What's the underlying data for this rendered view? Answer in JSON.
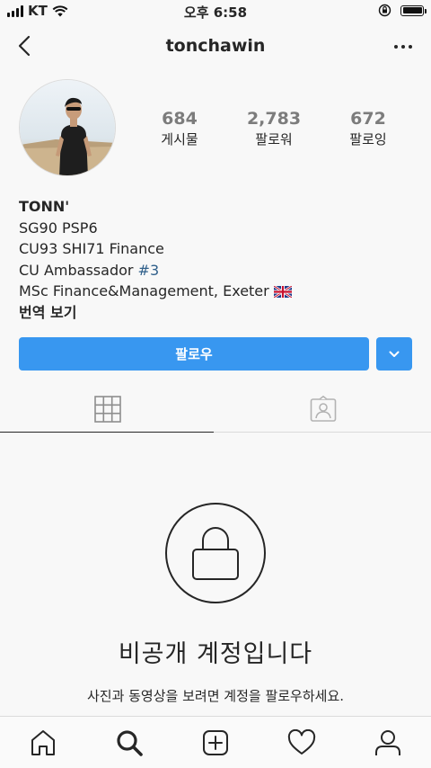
{
  "status_bar": {
    "carrier": "KT",
    "time": "오후 6:58"
  },
  "header": {
    "username": "tonchawin"
  },
  "profile": {
    "avatar": "profile-photo",
    "stats": [
      {
        "value": "684",
        "label": "게시물"
      },
      {
        "value": "2,783",
        "label": "팔로워"
      },
      {
        "value": "672",
        "label": "팔로잉"
      }
    ],
    "bio": {
      "name": "TONN'",
      "line1": "SG90 PSP6",
      "line2": "CU93 SHI71 Finance",
      "line3_text": "CU Ambassador ",
      "line3_hashtag": "#3",
      "line4": "MSc Finance&Management, Exeter",
      "translate_label": "번역 보기"
    }
  },
  "actions": {
    "follow_label": "팔로우"
  },
  "private": {
    "title": "비공개 계정입니다",
    "description": "사진과 동영상을 보려면 계정을 팔로우하세요."
  },
  "colors": {
    "accent": "#3897f0",
    "hashtag": "#2f5f8a",
    "background": "#f8f8f8"
  },
  "icons": {
    "tabs": [
      "grid-icon",
      "tagged-icon"
    ],
    "bottom_nav": [
      "home-icon",
      "search-icon",
      "add-post-icon",
      "activity-heart-icon",
      "profile-icon"
    ]
  }
}
